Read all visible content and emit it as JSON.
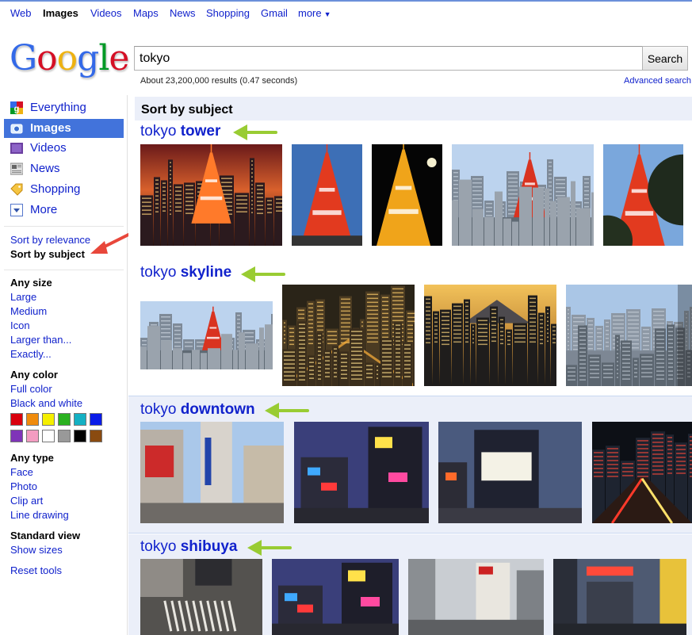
{
  "nav": {
    "items": [
      "Web",
      "Images",
      "Videos",
      "Maps",
      "News",
      "Shopping",
      "Gmail",
      "more"
    ],
    "active": "Images"
  },
  "logo": {
    "letters": [
      "G",
      "o",
      "o",
      "g",
      "l",
      "e"
    ],
    "colors": [
      "#3369e8",
      "#d50f25",
      "#eeb211",
      "#3369e8",
      "#009925",
      "#d50f25"
    ]
  },
  "search": {
    "value": "tokyo",
    "button": "Search",
    "stats": "About 23,200,000 results (0.47 seconds)",
    "advanced": "Advanced search"
  },
  "sidebar": {
    "items": [
      {
        "label": "Everything",
        "icon": "google-g-icon"
      },
      {
        "label": "Images",
        "icon": "camera-icon"
      },
      {
        "label": "Videos",
        "icon": "film-icon"
      },
      {
        "label": "News",
        "icon": "newspaper-icon"
      },
      {
        "label": "Shopping",
        "icon": "tag-icon"
      },
      {
        "label": "More",
        "icon": "dropdown-arrow-icon"
      }
    ],
    "selected": "Images",
    "sort": [
      "Sort by relevance",
      "Sort by subject"
    ],
    "size": {
      "heading": "Any size",
      "options": [
        "Large",
        "Medium",
        "Icon",
        "Larger than...",
        "Exactly..."
      ]
    },
    "color": {
      "heading": "Any color",
      "options": [
        "Full color",
        "Black and white"
      ],
      "swatches": [
        "#d9000d",
        "#f08b0c",
        "#f5ef00",
        "#2bb120",
        "#14b0c3",
        "#0a1ce8",
        "#7f34b8",
        "#f39cc1",
        "#ffffff",
        "#999999",
        "#000000",
        "#8a4b10"
      ]
    },
    "type": {
      "heading": "Any type",
      "options": [
        "Face",
        "Photo",
        "Clip art",
        "Line drawing"
      ]
    },
    "view": {
      "heading": "Standard view",
      "options": [
        "Show sizes"
      ]
    },
    "reset": "Reset tools"
  },
  "main": {
    "header": "Sort by subject",
    "sections": [
      {
        "prefix": "tokyo",
        "bold": "tower"
      },
      {
        "prefix": "tokyo",
        "bold": "skyline"
      },
      {
        "prefix": "tokyo",
        "bold": "downtown"
      },
      {
        "prefix": "tokyo",
        "bold": "shibuya"
      }
    ]
  },
  "colors": {
    "link": "#1122cc",
    "selected": "#4273db",
    "band": "#ebeff9",
    "arrow_green": "#99cc33",
    "arrow_red": "#e8473b"
  }
}
